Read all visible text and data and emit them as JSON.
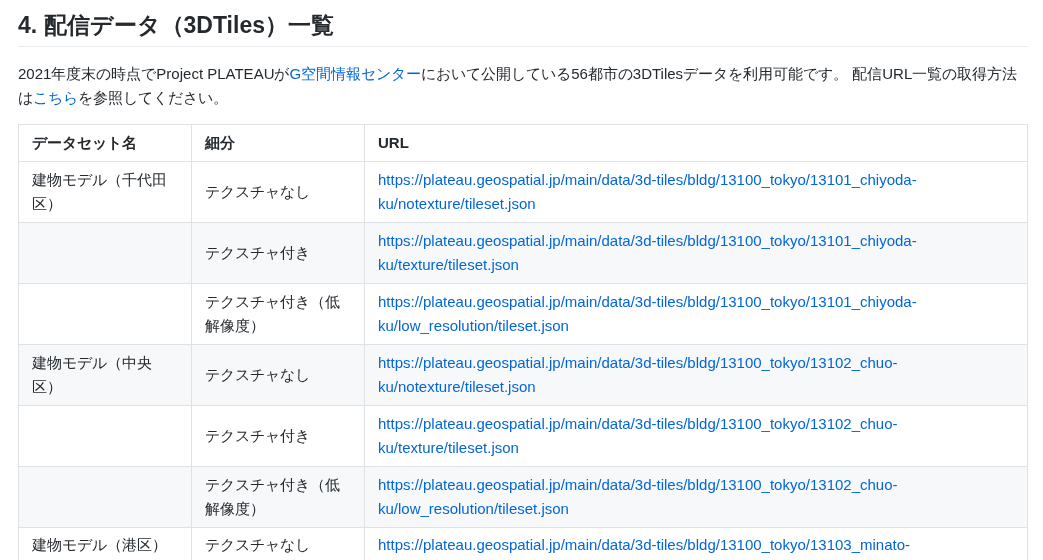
{
  "heading": "4. 配信データ（3DTiles）一覧",
  "intro": [
    {
      "kind": "text",
      "text": "2021年度末の時点でProject PLATEAUが"
    },
    {
      "kind": "link",
      "text": "G空間情報センター"
    },
    {
      "kind": "text",
      "text": "において公開している56都市の3DTilesデータを利用可能です。 配信URL一覧の取得方法は"
    },
    {
      "kind": "link",
      "text": "こちら"
    },
    {
      "kind": "text",
      "text": "を参照してください。"
    }
  ],
  "table": {
    "columns": [
      "データセット名",
      "細分",
      "URL"
    ],
    "rows": [
      {
        "dataset": "建物モデル（千代田区）",
        "variant": "テクスチャなし",
        "url": "https://plateau.geospatial.jp/main/data/3d-tiles/bldg/13100_tokyo/13101_chiyoda-ku/notexture/tileset.json"
      },
      {
        "variant": "テクスチャ付き",
        "url": "https://plateau.geospatial.jp/main/data/3d-tiles/bldg/13100_tokyo/13101_chiyoda-ku/texture/tileset.json"
      },
      {
        "variant": "テクスチャ付き（低解像度）",
        "url": "https://plateau.geospatial.jp/main/data/3d-tiles/bldg/13100_tokyo/13101_chiyoda-ku/low_resolution/tileset.json"
      },
      {
        "dataset": "建物モデル（中央区）",
        "variant": "テクスチャなし",
        "url": "https://plateau.geospatial.jp/main/data/3d-tiles/bldg/13100_tokyo/13102_chuo-ku/notexture/tileset.json"
      },
      {
        "variant": "テクスチャ付き",
        "url": "https://plateau.geospatial.jp/main/data/3d-tiles/bldg/13100_tokyo/13102_chuo-ku/texture/tileset.json"
      },
      {
        "variant": "テクスチャ付き（低解像度）",
        "url": "https://plateau.geospatial.jp/main/data/3d-tiles/bldg/13100_tokyo/13102_chuo-ku/low_resolution/tileset.json"
      },
      {
        "dataset": "建物モデル（港区）",
        "variant": "テクスチャなし",
        "url": "https://plateau.geospatial.jp/main/data/3d-tiles/bldg/13100_tokyo/13103_minato-"
      }
    ]
  }
}
